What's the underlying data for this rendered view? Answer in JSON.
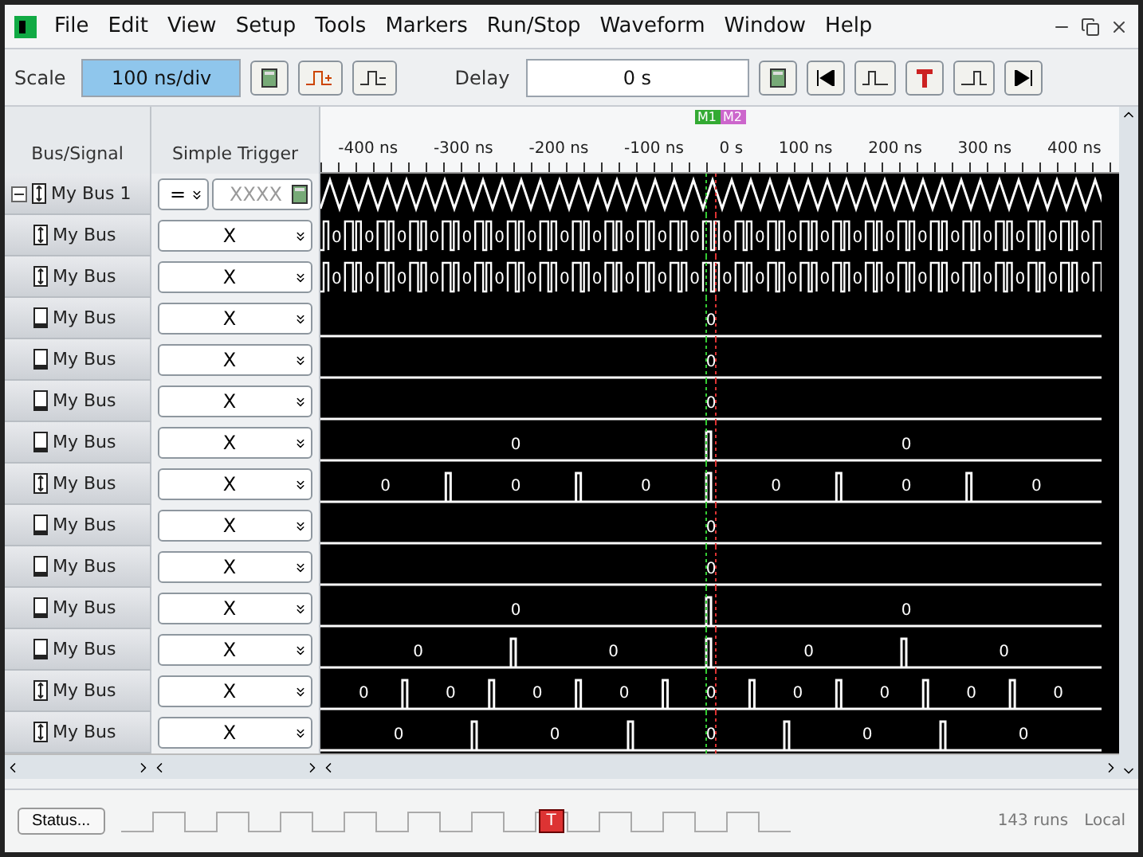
{
  "window": {
    "menu": [
      "File",
      "Edit",
      "View",
      "Setup",
      "Tools",
      "Markers",
      "Run/Stop",
      "Waveform",
      "Window",
      "Help"
    ]
  },
  "toolbar": {
    "scale_label": "Scale",
    "scale_value": "100 ns/div",
    "delay_label": "Delay",
    "delay_value": "0 s"
  },
  "columns": {
    "bus_signal": "Bus/Signal",
    "trigger": "Simple Trigger"
  },
  "ruler": {
    "ticks": [
      "-400 ns",
      "-300 ns",
      "-200 ns",
      "-100 ns",
      "0 s",
      "100 ns",
      "200 ns",
      "300 ns",
      "400 ns"
    ],
    "markers": [
      "M1",
      "M2"
    ]
  },
  "rows": [
    {
      "name": "My Bus 1",
      "kind": "bus",
      "expanded": true,
      "trigger_op": "=",
      "trigger_value": "XXXX",
      "trace": {
        "kind": "clock"
      },
      "children": [
        {
          "name": "My Bus",
          "kind": "bus",
          "trigger_value": "X",
          "trace": {
            "kind": "toggle",
            "values": [
              "0",
              "0",
              "0",
              "0",
              "0",
              "0",
              "0",
              "0",
              "0",
              "0",
              "0",
              "0",
              "0",
              "0",
              "0",
              "0",
              "0",
              "0",
              "0",
              "0",
              "0",
              "0",
              "0",
              "0"
            ]
          }
        },
        {
          "name": "My Bus",
          "kind": "bus",
          "trigger_value": "X",
          "trace": {
            "kind": "toggle",
            "values": [
              "0",
              "0",
              "0",
              "0",
              "0",
              "0",
              "0",
              "0",
              "0",
              "0",
              "0",
              "0",
              "0",
              "0",
              "0",
              "0",
              "0",
              "0",
              "0",
              "0",
              "0",
              "0",
              "0",
              "0"
            ]
          }
        },
        {
          "name": "My Bus",
          "kind": "signal",
          "trigger_value": "X",
          "trace": {
            "kind": "level",
            "values": [
              "0"
            ]
          }
        },
        {
          "name": "My Bus",
          "kind": "signal",
          "trigger_value": "X",
          "trace": {
            "kind": "level",
            "values": [
              "0"
            ]
          }
        },
        {
          "name": "My Bus",
          "kind": "signal",
          "trigger_value": "X",
          "trace": {
            "kind": "level",
            "values": [
              "0"
            ]
          }
        },
        {
          "name": "My Bus",
          "kind": "signal",
          "trigger_value": "X",
          "trace": {
            "kind": "level",
            "values": [
              "0",
              "0"
            ]
          }
        },
        {
          "name": "My Bus",
          "kind": "bus",
          "trigger_value": "X",
          "trace": {
            "kind": "level",
            "values": [
              "0",
              "0",
              "0",
              "0",
              "0",
              "0"
            ]
          }
        },
        {
          "name": "My Bus",
          "kind": "signal",
          "trigger_value": "X",
          "trace": {
            "kind": "level",
            "values": [
              "0"
            ]
          }
        },
        {
          "name": "My Bus",
          "kind": "signal",
          "trigger_value": "X",
          "trace": {
            "kind": "level",
            "values": [
              "0"
            ]
          }
        },
        {
          "name": "My Bus",
          "kind": "signal",
          "trigger_value": "X",
          "trace": {
            "kind": "level",
            "values": [
              "0",
              "0"
            ]
          }
        },
        {
          "name": "My Bus",
          "kind": "signal",
          "trigger_value": "X",
          "trace": {
            "kind": "level",
            "values": [
              "0",
              "0",
              "0",
              "0"
            ]
          }
        },
        {
          "name": "My Bus",
          "kind": "bus",
          "trigger_value": "X",
          "trace": {
            "kind": "level",
            "values": [
              "0",
              "0",
              "0",
              "0",
              "0",
              "0",
              "0",
              "0",
              "0"
            ]
          }
        },
        {
          "name": "My Bus",
          "kind": "bus",
          "trigger_value": "X",
          "trace": {
            "kind": "level",
            "values": [
              "0",
              "0",
              "0",
              "0",
              "0"
            ]
          }
        }
      ]
    }
  ],
  "bottom": {
    "trigger_marker": "T",
    "runs": "143 runs",
    "mode": "Local",
    "status_button": "Status..."
  }
}
